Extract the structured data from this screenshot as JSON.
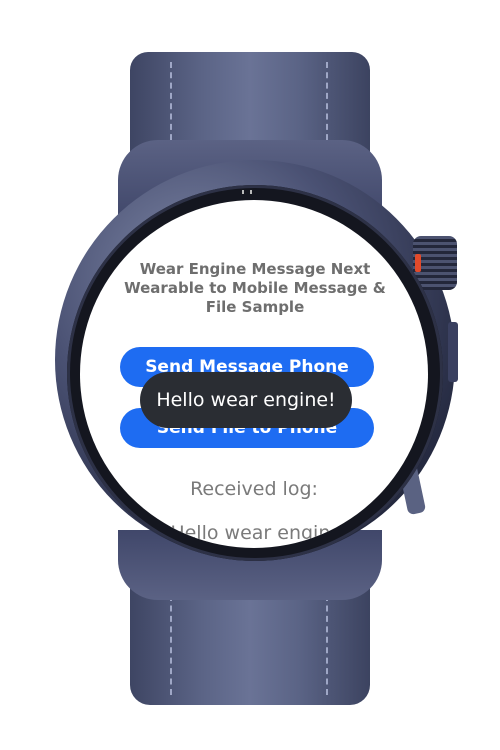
{
  "screen": {
    "title": "Wear Engine Message Next Wearable to Mobile Message & File Sample",
    "buttons": {
      "send_message": "Send Message Phone",
      "send_file": "Send File to Phone"
    },
    "received_label": "Received log:",
    "log_entries": [
      "Hello wear engine!"
    ]
  },
  "toast": {
    "text": "Hello wear engine!"
  },
  "colors": {
    "button": "#1e6cf2",
    "toast_bg": "#2a2d33",
    "text_gray": "#7a7a7a",
    "strap": "#5b6486",
    "crown_accent": "#e24a2b"
  }
}
